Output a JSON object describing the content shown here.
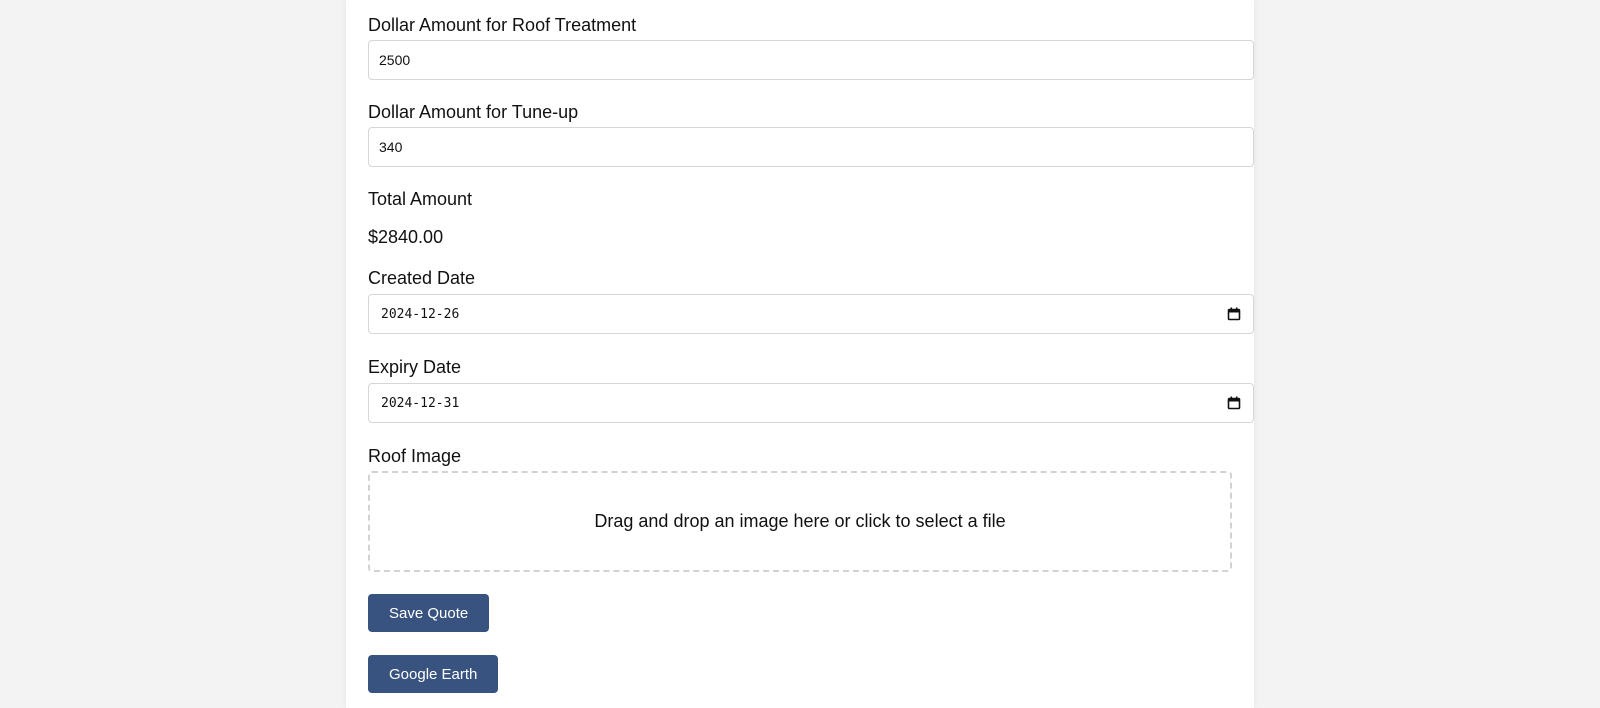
{
  "form": {
    "roof_treatment": {
      "label": "Dollar Amount for Roof Treatment",
      "value": "2500"
    },
    "tune_up": {
      "label": "Dollar Amount for Tune-up",
      "value": "340"
    },
    "total": {
      "label": "Total Amount",
      "value": "$2840.00"
    },
    "created_date": {
      "label": "Created Date",
      "value": "2024-12-26",
      "icon": "calendar-icon"
    },
    "expiry_date": {
      "label": "Expiry Date",
      "value": "2024-12-31",
      "icon": "calendar-icon"
    },
    "roof_image": {
      "label": "Roof Image",
      "dropzone_text": "Drag and drop an image here or click to select a file"
    }
  },
  "buttons": {
    "save_quote": "Save Quote",
    "google_earth": "Google Earth"
  },
  "colors": {
    "button_bg": "#38537f",
    "page_bg": "#f3f3f3",
    "panel_bg": "#ffffff"
  }
}
